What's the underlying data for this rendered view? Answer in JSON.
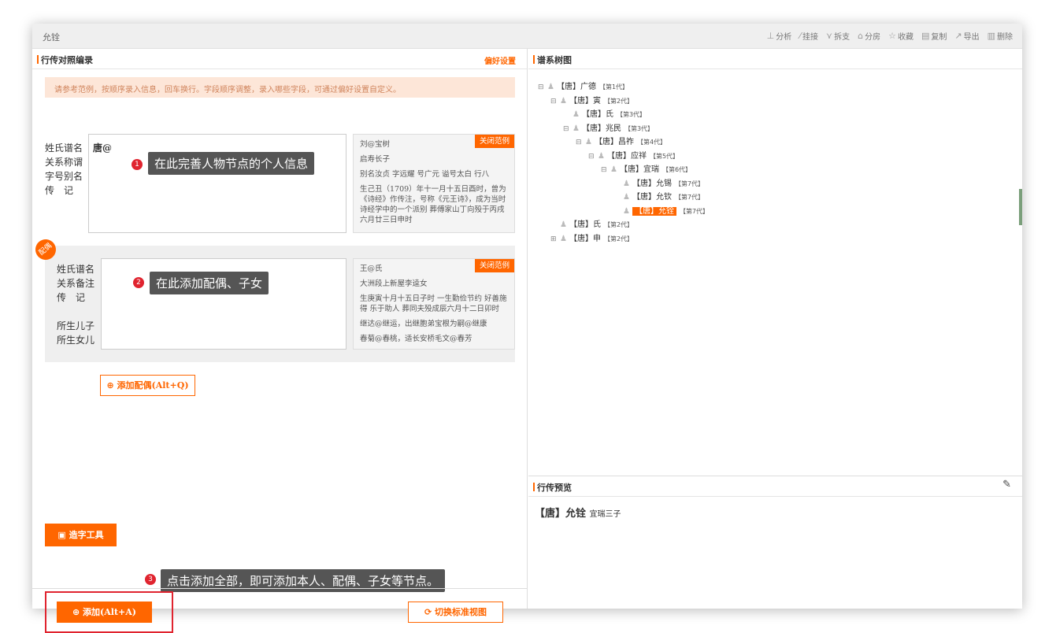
{
  "window": {
    "title": "允铨"
  },
  "toolbar": [
    {
      "icon": "chart-icon",
      "glyph": "⊥",
      "label": "分析"
    },
    {
      "icon": "link-icon",
      "glyph": "⁄",
      "label": "挂接"
    },
    {
      "icon": "split-icon",
      "glyph": "⋎",
      "label": "拆支"
    },
    {
      "icon": "house-icon",
      "glyph": "⌂",
      "label": "分房"
    },
    {
      "icon": "star-icon",
      "glyph": "☆",
      "label": "收藏"
    },
    {
      "icon": "copy-icon",
      "glyph": "▤",
      "label": "复制"
    },
    {
      "icon": "export-icon",
      "glyph": "↗",
      "label": "导出"
    },
    {
      "icon": "trash-icon",
      "glyph": "▥",
      "label": "删除"
    }
  ],
  "left": {
    "header": "行传对照编录",
    "pref_link": "偏好设置",
    "notice": "请参考范例，按顺序录入信息，回车换行。字段顺序调整，录入哪些字段，可通过偏好设置自定义。",
    "person": {
      "labels": [
        "姓氏谱名",
        "关系称谓",
        "字号别名",
        "传　记"
      ],
      "input_value": "唐@",
      "tip": "在此完善人物节点的个人信息",
      "tip_num": "1",
      "example_close": "关闭范例",
      "example": [
        "刘@宝树",
        "启寿长子",
        "别名汝贞 字远耀 号广元 谥号太白 行八",
        "生己丑（1709）年十一月十五日酉时，曾为《诗经》作传注，号称《元王诗》，成为当时诗经学中的一个派别 葬傅家山丁向殁于丙戌六月廿三日申时"
      ]
    },
    "spouse": {
      "badge": "配偶",
      "labels": [
        "姓氏谱名",
        "关系备注",
        "传　记",
        "",
        "所生儿子",
        "所生女儿"
      ],
      "tip": "在此添加配偶、子女",
      "tip_num": "2",
      "example_close": "关闭范例",
      "example": [
        "王@氏",
        "大洲段上新屋李逵女",
        "生庚寅十月十五日子时 一生勤俭节约 好善施得 乐于助人 葬同夫殁成辰六月十二日卯时",
        "继达@继运，出继胞弟宝根为嗣@继康",
        "春菊@春桃，适长安桥毛文@春芳"
      ]
    },
    "add_spouse": "添加配偶(Alt+Q)",
    "char_tool": "造字工具",
    "tip3": "点击添加全部，即可添加本人、配偶、子女等节点。",
    "tip3_num": "3",
    "add_btn": "添加(Alt+A)",
    "switch_btn": "切换标准视图"
  },
  "right": {
    "header": "谱系树图",
    "tree": [
      {
        "toggle": "⊟",
        "name": "【唐】广德",
        "gen": "【第1代】",
        "selected": false
      },
      {
        "toggle": "⊟",
        "name": "【唐】寅",
        "gen": "【第2代】",
        "selected": false
      },
      {
        "toggle": "",
        "name": "【唐】氏",
        "gen": "【第3代】",
        "selected": false
      },
      {
        "toggle": "⊟",
        "name": "【唐】兆民",
        "gen": "【第3代】",
        "selected": false
      },
      {
        "toggle": "⊟",
        "name": "【唐】昌祚",
        "gen": "【第4代】",
        "selected": false
      },
      {
        "toggle": "⊟",
        "name": "【唐】应祥",
        "gen": "【第5代】",
        "selected": false
      },
      {
        "toggle": "⊟",
        "name": "【唐】宜瑞",
        "gen": "【第6代】",
        "selected": false
      },
      {
        "toggle": "",
        "name": "【唐】允锡",
        "gen": "【第7代】",
        "selected": false
      },
      {
        "toggle": "",
        "name": "【唐】允钦",
        "gen": "【第7代】",
        "selected": false
      },
      {
        "toggle": "",
        "name": "【唐】允铨",
        "gen": "【第7代】",
        "selected": true
      },
      {
        "toggle": "",
        "name": "【唐】氏",
        "gen": "【第2代】",
        "selected": false
      },
      {
        "toggle": "⊞",
        "name": "【唐】申",
        "gen": "【第2代】",
        "selected": false
      }
    ],
    "preview_header": "行传预览",
    "preview_name": "【唐】允铨",
    "preview_note": "宜瑞三子"
  }
}
